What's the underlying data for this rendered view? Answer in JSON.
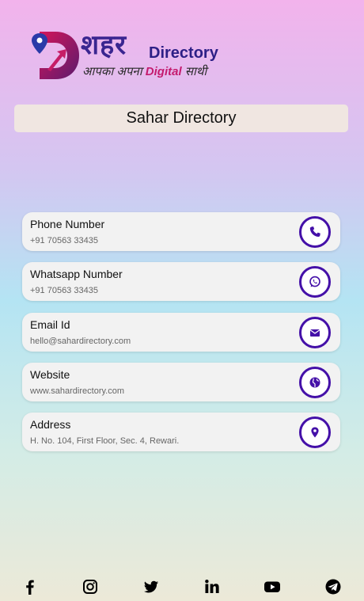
{
  "logo": {
    "hindi_main": "शहर",
    "brand_en": "Directory",
    "tagline_pre": "आपका अपना",
    "tagline_digital": "Digital",
    "tagline_post": "साथी",
    "colors": {
      "primary": "#3a2590",
      "accent": "#c41b6e"
    }
  },
  "header": {
    "title": "Sahar Directory"
  },
  "contacts": [
    {
      "label": "Phone Number",
      "value": "+91 70563 33435",
      "icon": "phone-icon"
    },
    {
      "label": "Whatsapp Number",
      "value": "+91 70563 33435",
      "icon": "whatsapp-icon"
    },
    {
      "label": "Email Id",
      "value": "hello@sahardirectory.com",
      "icon": "mail-icon"
    },
    {
      "label": "Website",
      "value": "www.sahardirectory.com",
      "icon": "globe-icon"
    },
    {
      "label": "Address",
      "value": "H. No. 104, First Floor, Sec. 4, Rewari.",
      "icon": "location-pin-icon"
    }
  ],
  "social": [
    "facebook-icon",
    "instagram-icon",
    "twitter-icon",
    "linkedin-icon",
    "youtube-icon",
    "telegram-icon"
  ],
  "colors": {
    "icon_ring": "#4410a8",
    "card_bg": "#f2f2f2",
    "title_bg": "#f0e6e1"
  }
}
